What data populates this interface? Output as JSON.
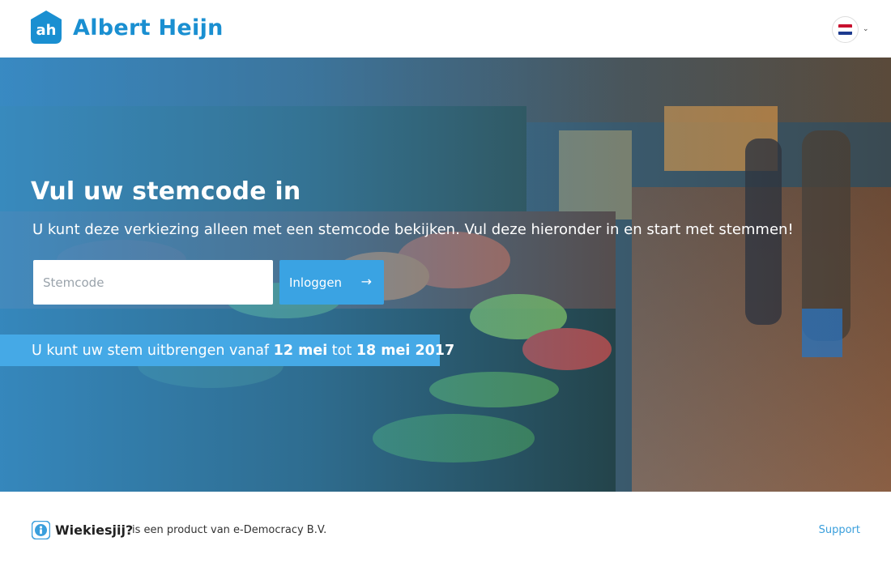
{
  "header": {
    "brand": "Albert Heijn",
    "logo_letters": "ah",
    "language_flag": "nl-flag-icon",
    "colors": {
      "brand": "#1a8fd1"
    }
  },
  "hero": {
    "title": "Vul uw stemcode in",
    "subtitle": "U kunt deze verkiezing alleen met een stemcode bekijken. Vul deze hieronder in en start met stemmen!",
    "code_input": {
      "placeholder": "Stemcode",
      "value": ""
    },
    "login_button": {
      "label": "Inloggen",
      "icon": "arrow-right-icon"
    },
    "period": {
      "prefix": "U kunt uw stem uitbrengen vanaf",
      "start": "12 mei",
      "middle": "tot",
      "end": "18 mei 2017"
    },
    "colors": {
      "accent": "#3aa3e3",
      "bar": "#45a9e6"
    }
  },
  "footer": {
    "product_name": "Wiekiesjij?",
    "product_text": "is een product van e-Democracy B.V.",
    "support_label": "Support",
    "colors": {
      "link": "#3a9fdc"
    }
  }
}
